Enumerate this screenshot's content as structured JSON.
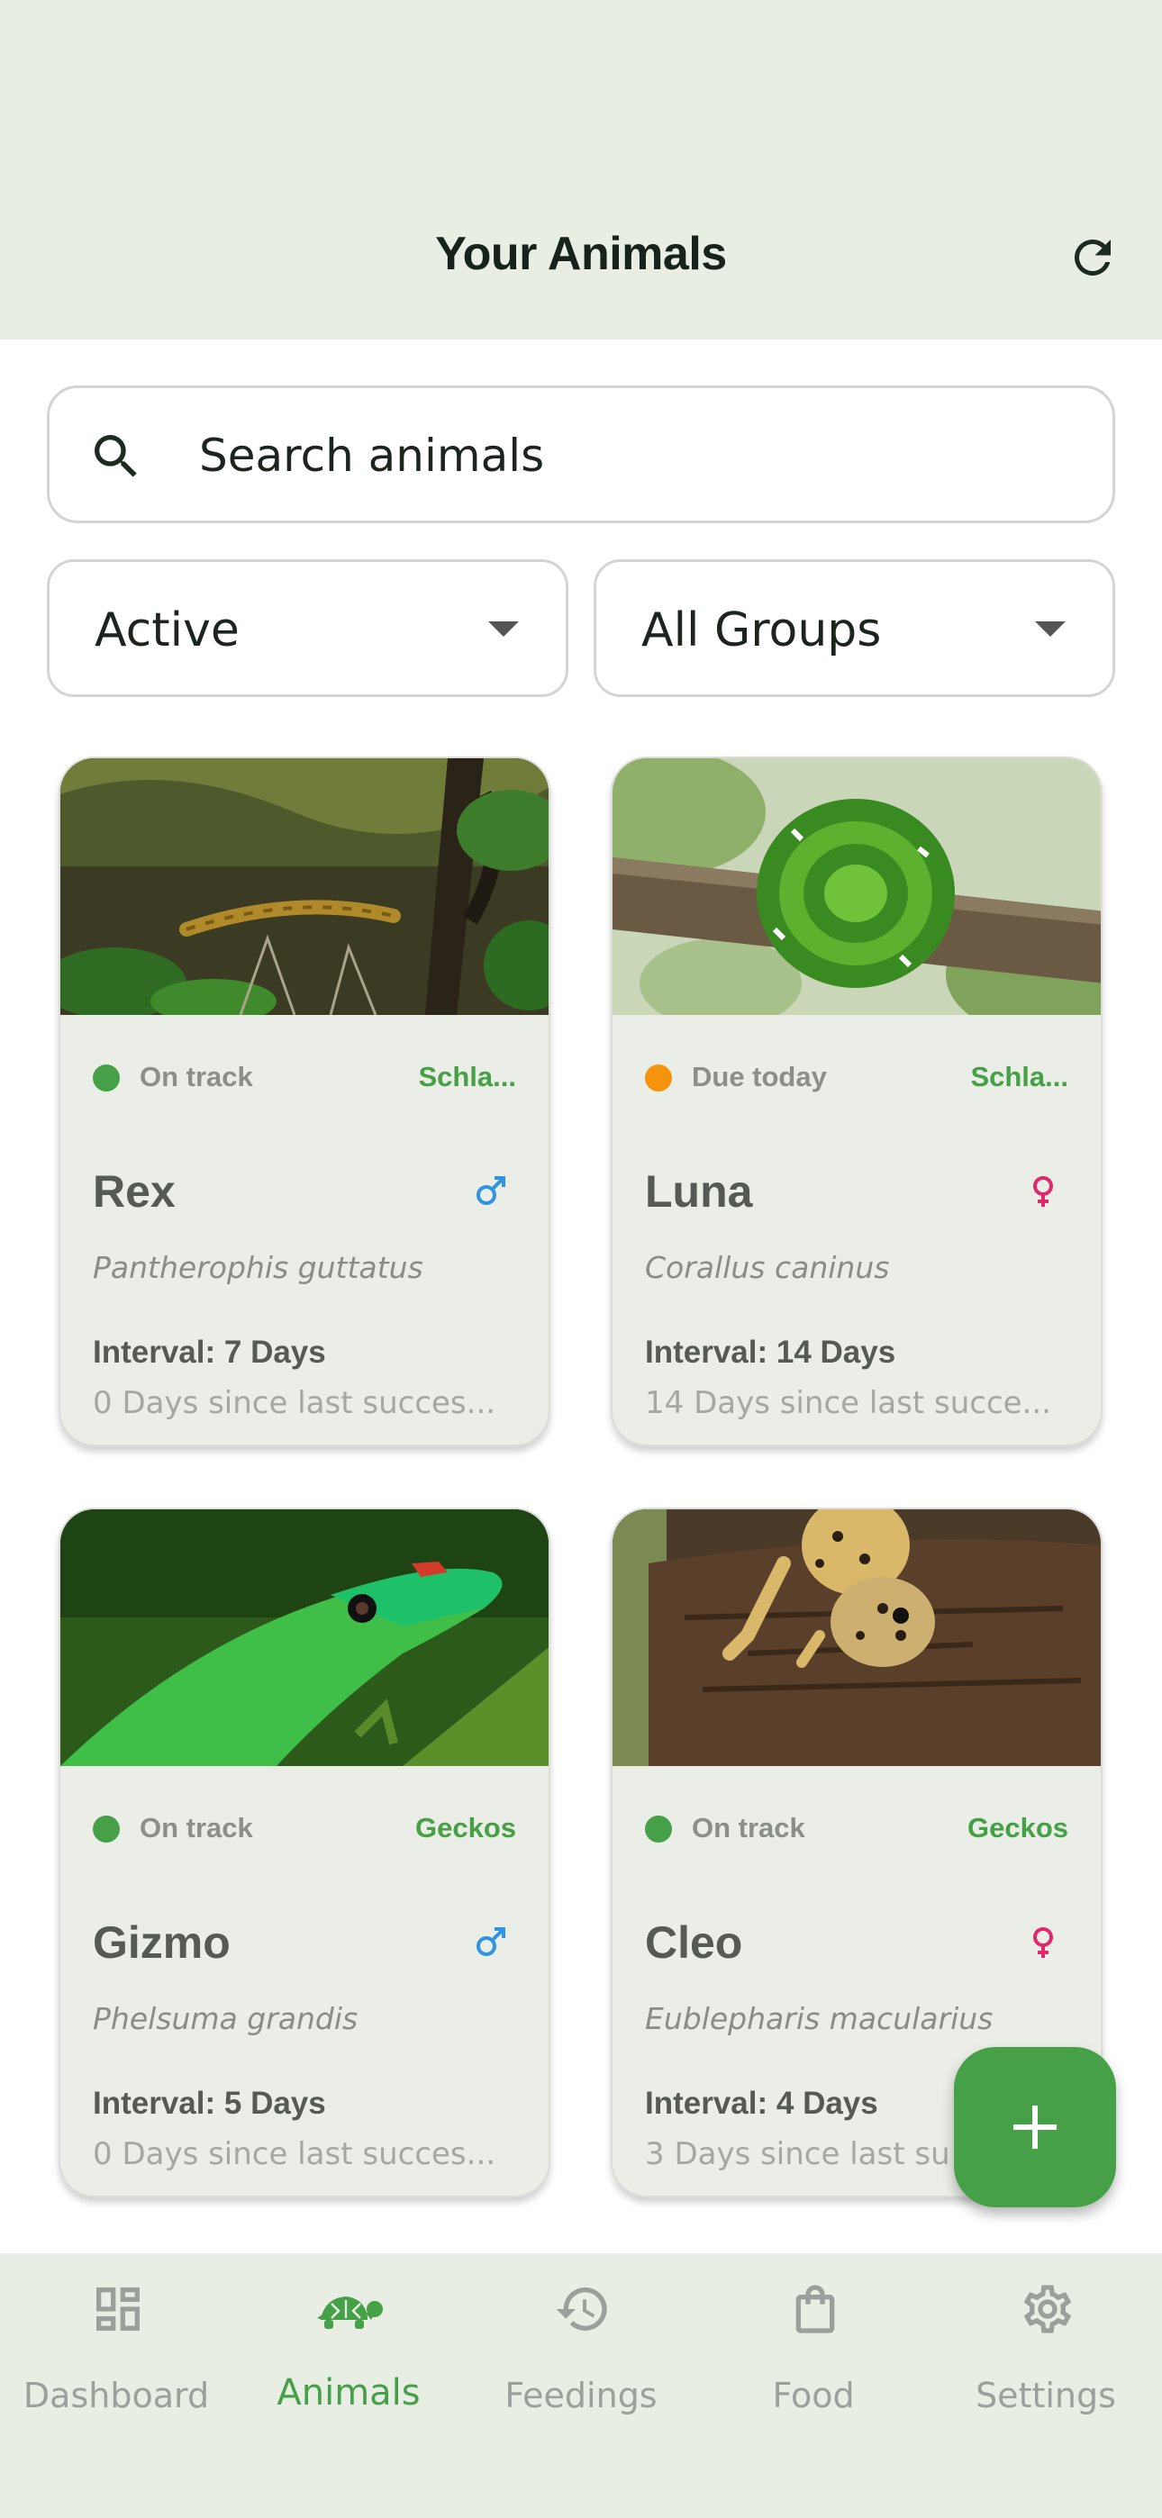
{
  "header": {
    "title": "Your Animals",
    "refresh_icon": "refresh-icon"
  },
  "search": {
    "placeholder": "Search animals",
    "value": ""
  },
  "filters": {
    "status": {
      "selected": "Active"
    },
    "group": {
      "selected": "All Groups"
    }
  },
  "colors": {
    "accent": "#46a048",
    "on_track": "#46a048",
    "due_today": "#f5940c",
    "male": "#2e94e3",
    "female": "#e0296c"
  },
  "animals": [
    {
      "name": "Rex",
      "species": "Pantherophis guttatus",
      "status": "On track",
      "group": "Schla...",
      "gender": "male",
      "interval": "Interval: 7 Days",
      "since": "0 Days since last succes...",
      "photo": "corn-snake"
    },
    {
      "name": "Luna",
      "species": "Corallus caninus",
      "status": "Due today",
      "group": "Schla...",
      "gender": "female",
      "interval": "Interval: 14 Days",
      "since": "14 Days since last succe...",
      "photo": "emerald-tree-boa"
    },
    {
      "name": "Gizmo",
      "species": "Phelsuma grandis",
      "status": "On track",
      "group": "Geckos",
      "gender": "male",
      "interval": "Interval: 5 Days",
      "since": "0 Days since last succes...",
      "photo": "day-gecko"
    },
    {
      "name": "Cleo",
      "species": "Eublepharis macularius",
      "status": "On track",
      "group": "Geckos",
      "gender": "female",
      "interval": "Interval: 4 Days",
      "since": "3 Days since last su",
      "photo": "leopard-gecko"
    }
  ],
  "fab": {
    "icon": "plus-icon"
  },
  "nav": {
    "items": [
      {
        "label": "Dashboard",
        "icon": "dashboard-icon"
      },
      {
        "label": "Animals",
        "icon": "turtle-icon",
        "active": true
      },
      {
        "label": "Feedings",
        "icon": "history-icon"
      },
      {
        "label": "Food",
        "icon": "shopping-bag-icon"
      },
      {
        "label": "Settings",
        "icon": "gear-icon"
      }
    ]
  }
}
